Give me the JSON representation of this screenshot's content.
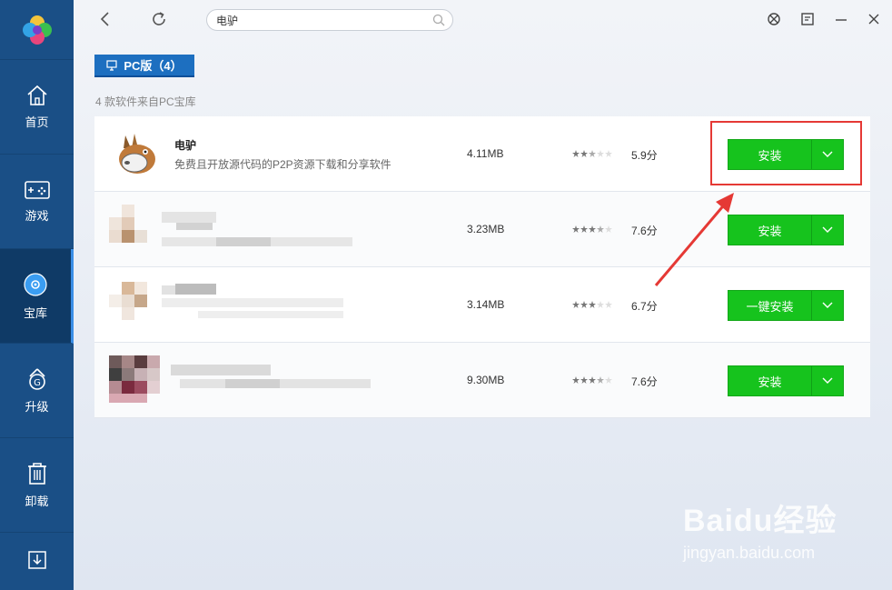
{
  "app": {
    "search_value": "电驴",
    "tab_label": "PC版（4）",
    "result_count": "4 款软件来自PC宝库"
  },
  "sidebar": {
    "items": [
      {
        "label": "首页",
        "icon": "home-icon"
      },
      {
        "label": "游戏",
        "icon": "gamepad-icon"
      },
      {
        "label": "宝库",
        "icon": "disc-icon"
      },
      {
        "label": "升级",
        "icon": "upgrade-icon"
      },
      {
        "label": "卸载",
        "icon": "trash-icon"
      }
    ],
    "active": "宝库"
  },
  "apps": [
    {
      "name": "电驴",
      "desc": "免费且开放源代码的P2P资源下载和分享软件",
      "size": "4.11MB",
      "rating": 2.5,
      "score": "5.9分",
      "button": "安装"
    },
    {
      "name": "",
      "desc": "",
      "size": "3.23MB",
      "rating": 3.5,
      "score": "7.6分",
      "button": "安装"
    },
    {
      "name": "",
      "desc": "",
      "size": "3.14MB",
      "rating": 3,
      "score": "6.7分",
      "button": "一键安装"
    },
    {
      "name": "",
      "desc": "",
      "size": "9.30MB",
      "rating": 3.5,
      "score": "7.6分",
      "button": "安装"
    }
  ],
  "watermark": {
    "main": "Baidu经验",
    "sub": "jingyan.baidu.com"
  },
  "colors": {
    "sidebar": "#1a4f86",
    "install_green": "#16c31d",
    "tab_blue": "#1d6fc0",
    "annotation_red": "#e53935"
  }
}
